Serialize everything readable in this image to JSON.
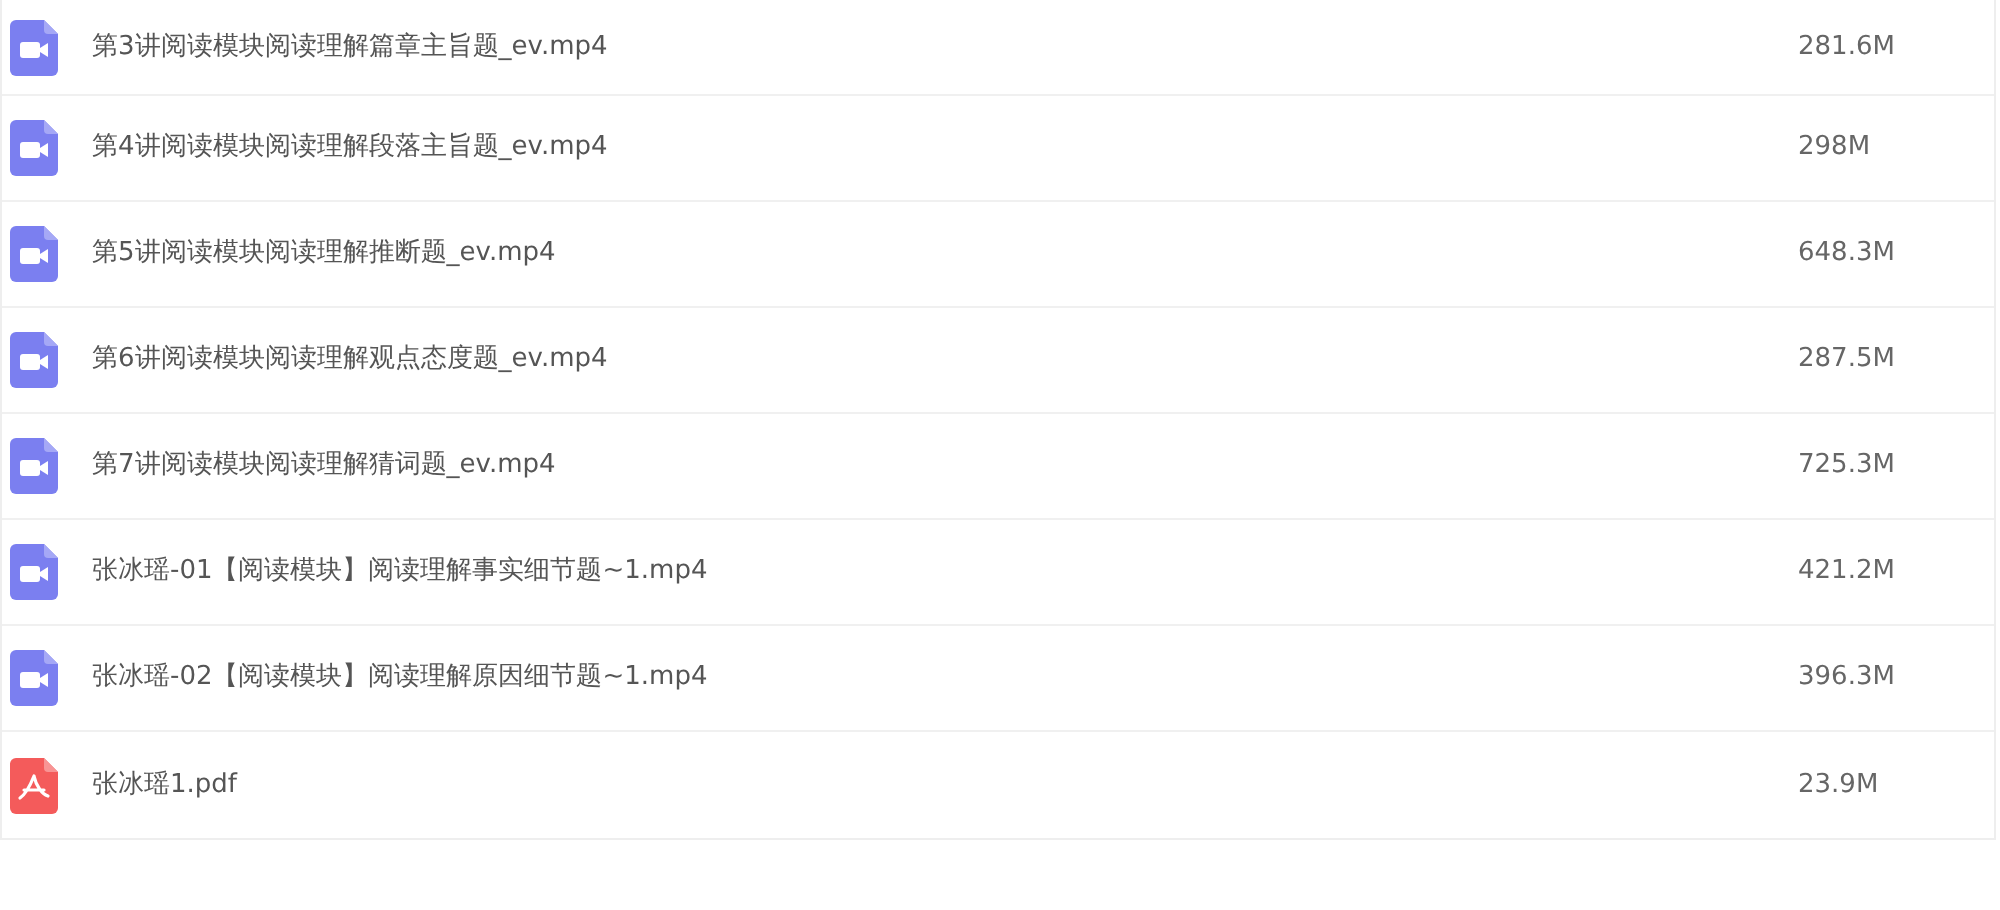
{
  "files": [
    {
      "kind": "video",
      "name": "第3讲阅读模块阅读理解篇章主旨题_ev.mp4",
      "size": "281.6M"
    },
    {
      "kind": "video",
      "name": "第4讲阅读模块阅读理解段落主旨题_ev.mp4",
      "size": "298M"
    },
    {
      "kind": "video",
      "name": "第5讲阅读模块阅读理解推断题_ev.mp4",
      "size": "648.3M"
    },
    {
      "kind": "video",
      "name": "第6讲阅读模块阅读理解观点态度题_ev.mp4",
      "size": "287.5M"
    },
    {
      "kind": "video",
      "name": "第7讲阅读模块阅读理解猜词题_ev.mp4",
      "size": "725.3M"
    },
    {
      "kind": "video",
      "name": "张冰瑶-01【阅读模块】阅读理解事实细节题~1.mp4",
      "size": "421.2M"
    },
    {
      "kind": "video",
      "name": "张冰瑶-02【阅读模块】阅读理解原因细节题~1.mp4",
      "size": "396.3M"
    },
    {
      "kind": "pdf",
      "name": "张冰瑶1.pdf",
      "size": "23.9M"
    }
  ]
}
